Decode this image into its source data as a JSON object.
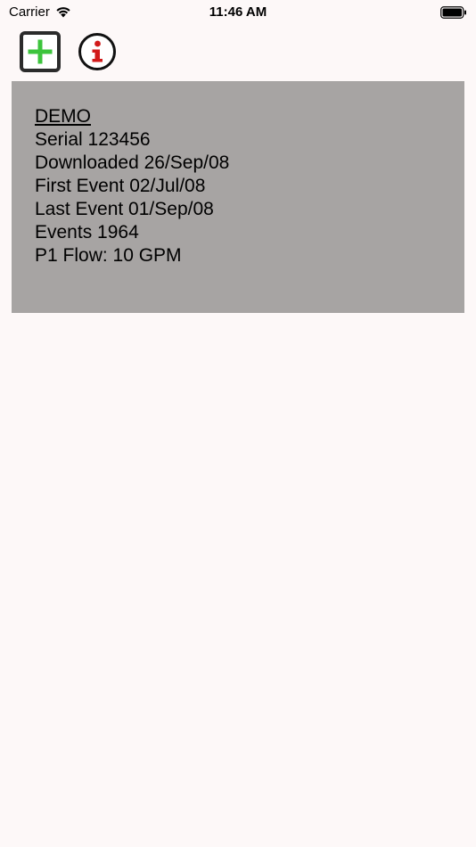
{
  "status_bar": {
    "carrier": "Carrier",
    "time": "11:46 AM"
  },
  "toolbar": {
    "add_icon": "plus-square-icon",
    "info_icon": "info-circle-icon",
    "add_color": "#3cc43c",
    "info_color": "#d11a1a"
  },
  "device_card": {
    "name": "DEMO",
    "serial": "Serial 123456",
    "downloaded": "Downloaded 26/Sep/08",
    "first_event": "First Event 02/Jul/08",
    "last_event": "Last Event 01/Sep/08",
    "events": "Events 1964",
    "flow": "P1 Flow: 10 GPM",
    "background": "#a7a4a3"
  }
}
